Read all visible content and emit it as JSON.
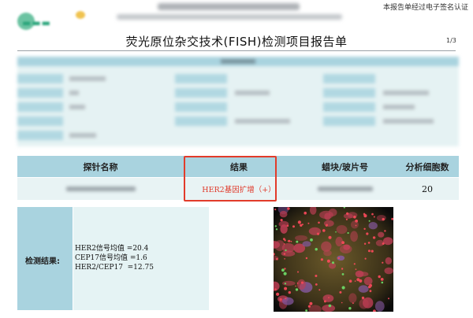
{
  "header": {
    "certification": "本报告单经过电子签名认证",
    "title": "荧光原位杂交技术(FISH)检测项目报告单",
    "page": "1/3"
  },
  "colors": {
    "header_bg": "#a9d3df",
    "cell_bg": "#e8f3f4",
    "result_red": "#e0392a",
    "highlight_border": "#e23b2a"
  },
  "table": {
    "columns": [
      "探针名称",
      "结果",
      "蜡块/玻片号",
      "分析细胞数"
    ],
    "rows": [
      {
        "result": "HER2基因扩增（+）",
        "cell_count": "20"
      }
    ]
  },
  "detection": {
    "label": "检测结果:",
    "lines": [
      "HER2信号均值 =20.4",
      "CEP17信号均值 =1.6",
      "HER2/CEP17  =12.75"
    ]
  }
}
